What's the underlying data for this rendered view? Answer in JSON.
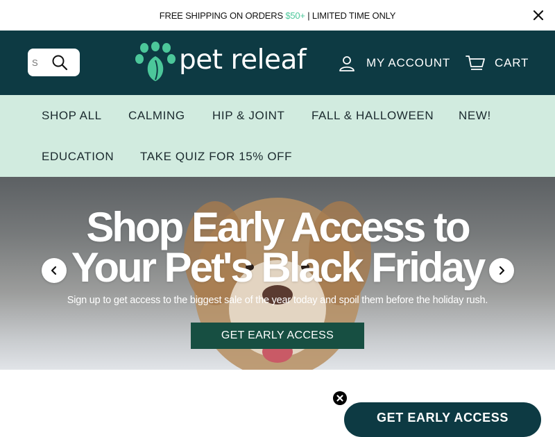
{
  "announcement": {
    "text_before": "FREE SHIPPING ON ORDERS ",
    "highlight": "$50+",
    "text_after": " | LIMITED TIME ONLY"
  },
  "header": {
    "search_value": "S",
    "logo_text": "pet releaf",
    "account_label": "MY ACCOUNT",
    "cart_label": "CART"
  },
  "nav": {
    "items": [
      {
        "label": "SHOP ALL"
      },
      {
        "label": "CALMING"
      },
      {
        "label": "HIP & JOINT"
      },
      {
        "label": "FALL & HALLOWEEN"
      },
      {
        "label": "NEW!"
      },
      {
        "label": "EDUCATION"
      },
      {
        "label": "TAKE QUIZ FOR 15% OFF"
      }
    ]
  },
  "hero": {
    "title_line1": "Shop Early Access to",
    "title_line2": "Your Pet's Black Friday",
    "subtitle": "Sign up to get access to the biggest sale of the year today and spoil them before the holiday rush.",
    "cta": "GET EARLY ACCESS"
  },
  "floating": {
    "button_label": "GET EARLY ACCESS"
  },
  "colors": {
    "header_bg": "#0d3a43",
    "nav_bg": "#d1ebdf",
    "accent": "#4cc79a",
    "cta_bg": "#174f42"
  }
}
